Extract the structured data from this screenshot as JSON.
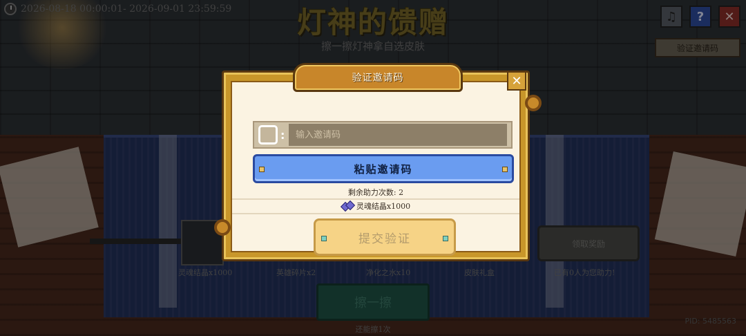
{
  "timebar": {
    "text": "2026-08-18 00:00:01- 2026-09-01 23:59:59"
  },
  "header": {
    "title": "灯神的馈赠",
    "subtitle": "擦一擦灯神拿自选皮肤",
    "verify_button": "验证邀请码"
  },
  "top_buttons": {
    "music": "♫",
    "help": "?",
    "close": "✕"
  },
  "scene": {
    "slots": [
      "灵魂结晶x1000",
      "英雄碎片x2",
      "净化之水x10",
      "皮肤礼盒"
    ],
    "claim_button": "领取奖励",
    "helpers_text": "已有0人为您助力!",
    "rub_button": "擦一擦",
    "rub_remaining": "还能擦1次",
    "pid": "PID: 5485563"
  },
  "dialog": {
    "title": "验证邀请码",
    "input_placeholder": "输入邀请码",
    "input_value": "",
    "paste_button": "粘贴邀请码",
    "remaining": "剩余助力次数: 2",
    "reward": "灵魂结晶x1000",
    "reward_icon": "crystal-icon",
    "submit_button": "提交验证",
    "close": "✕"
  },
  "colors": {
    "frame_gold": "#c8962a",
    "paste_blue": "#6a9cf0",
    "submit_gold": "#f6d386",
    "dialog_bg": "#fbf3e2"
  }
}
